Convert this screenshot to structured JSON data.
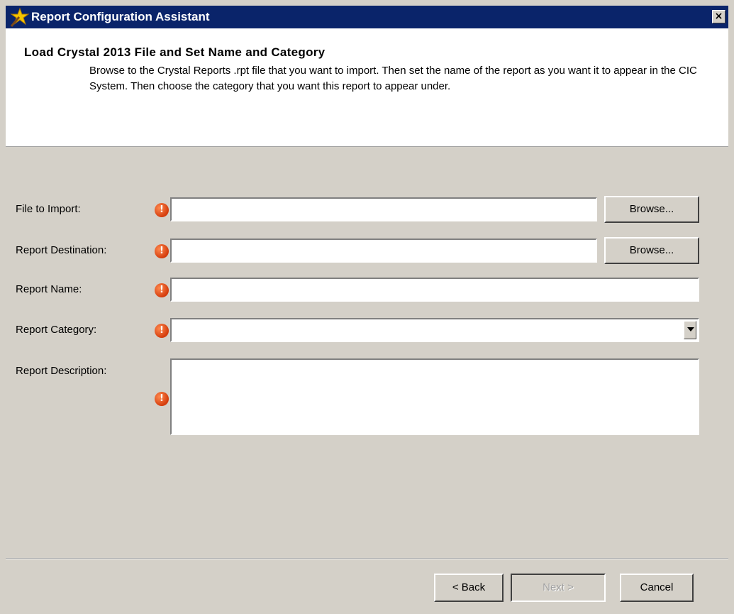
{
  "window": {
    "title": "Report Configuration Assistant",
    "close_glyph": "×"
  },
  "header": {
    "title": "Load Crystal 2013 File and Set Name and Category",
    "description": "Browse to the Crystal Reports .rpt file that you want to import.  Then set the name of the report as you want it to appear in the CIC System.  Then choose the category that you want this report to appear under."
  },
  "form": {
    "file_label": "File to Import:",
    "file_value": "",
    "destination_label": "Report Destination:",
    "destination_value": "",
    "name_label": "Report Name:",
    "name_value": "",
    "category_label": "Report Category:",
    "category_value": "",
    "description_label": "Report Description:",
    "description_value": "",
    "browse_label": "Browse...",
    "warning_glyph": "!"
  },
  "buttons": {
    "back": "< Back",
    "next": "Next >",
    "cancel": "Cancel"
  },
  "icons": {
    "title_icon": "wizard-wand-icon",
    "warning_icon": "error-circle-icon",
    "dropdown_icon": "chevron-down-icon"
  },
  "colors": {
    "titlebar": "#0a246a",
    "warning": "#d43c0c",
    "dialog": "#d4d0c8"
  }
}
